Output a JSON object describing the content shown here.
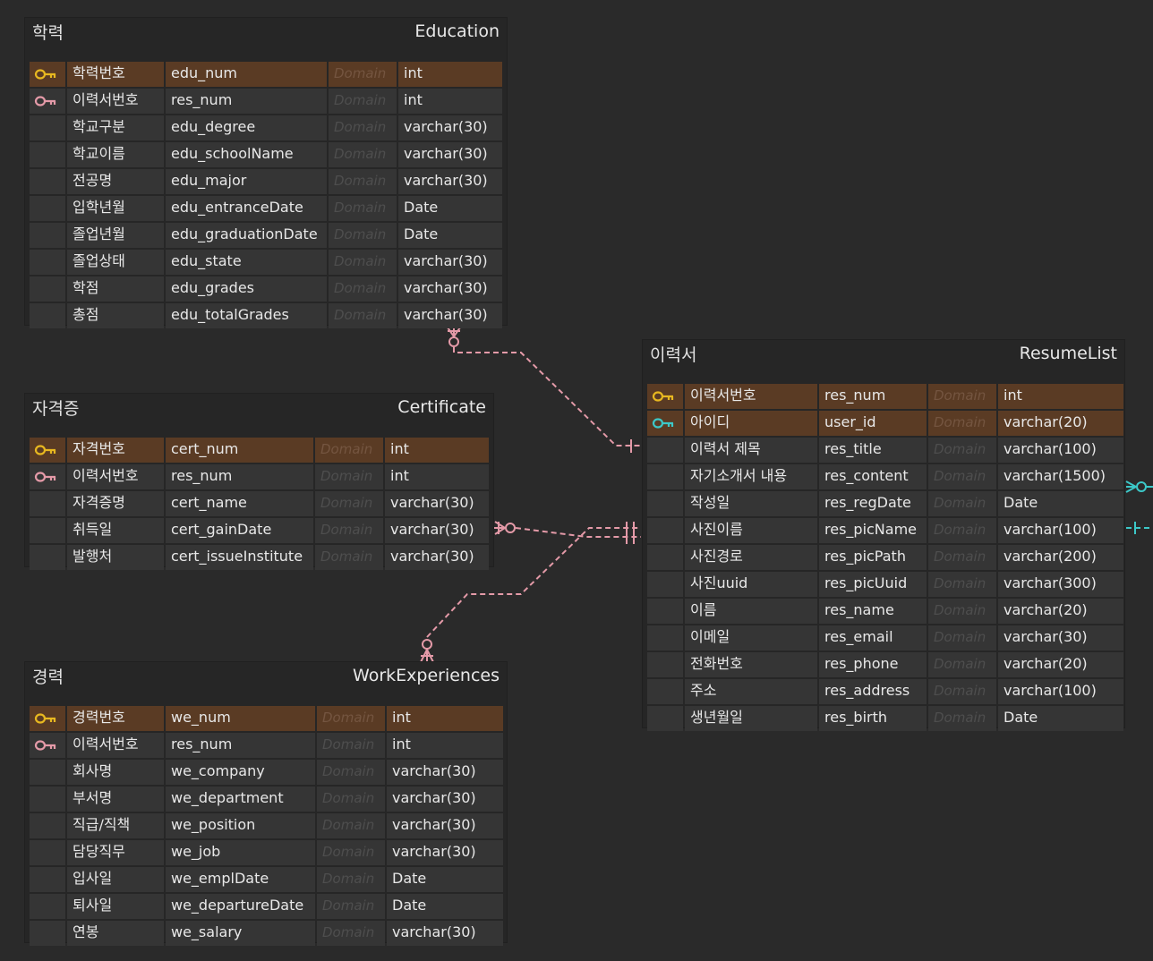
{
  "domain_placeholder": "Domain",
  "tables": {
    "education": {
      "ko": "학력",
      "en": "Education",
      "rows": [
        {
          "ko": "학력번호",
          "col": "edu_num",
          "type": "int",
          "key": "pk"
        },
        {
          "ko": "이력서번호",
          "col": "res_num",
          "type": "int",
          "key": "fk"
        },
        {
          "ko": "학교구분",
          "col": "edu_degree",
          "type": "varchar(30)",
          "key": ""
        },
        {
          "ko": "학교이름",
          "col": "edu_schoolName",
          "type": "varchar(30)",
          "key": ""
        },
        {
          "ko": "전공명",
          "col": "edu_major",
          "type": "varchar(30)",
          "key": ""
        },
        {
          "ko": "입학년월",
          "col": "edu_entranceDate",
          "type": "Date",
          "key": ""
        },
        {
          "ko": "졸업년월",
          "col": "edu_graduationDate",
          "type": "Date",
          "key": ""
        },
        {
          "ko": "졸업상태",
          "col": "edu_state",
          "type": "varchar(30)",
          "key": ""
        },
        {
          "ko": "학점",
          "col": "edu_grades",
          "type": "varchar(30)",
          "key": ""
        },
        {
          "ko": "총점",
          "col": "edu_totalGrades",
          "type": "varchar(30)",
          "key": ""
        }
      ]
    },
    "certificate": {
      "ko": "자격증",
      "en": "Certificate",
      "rows": [
        {
          "ko": "자격번호",
          "col": "cert_num",
          "type": "int",
          "key": "pk"
        },
        {
          "ko": "이력서번호",
          "col": "res_num",
          "type": "int",
          "key": "fk"
        },
        {
          "ko": "자격증명",
          "col": "cert_name",
          "type": "varchar(30)",
          "key": ""
        },
        {
          "ko": "취득일",
          "col": "cert_gainDate",
          "type": "varchar(30)",
          "key": ""
        },
        {
          "ko": "발행처",
          "col": "cert_issueInstitute",
          "type": "varchar(30)",
          "key": ""
        }
      ]
    },
    "work": {
      "ko": "경력",
      "en": "WorkExperiences",
      "rows": [
        {
          "ko": "경력번호",
          "col": "we_num",
          "type": "int",
          "key": "pk"
        },
        {
          "ko": "이력서번호",
          "col": "res_num",
          "type": "int",
          "key": "fk"
        },
        {
          "ko": "회사명",
          "col": "we_company",
          "type": "varchar(30)",
          "key": ""
        },
        {
          "ko": "부서명",
          "col": "we_department",
          "type": "varchar(30)",
          "key": ""
        },
        {
          "ko": "직급/직책",
          "col": "we_position",
          "type": "varchar(30)",
          "key": ""
        },
        {
          "ko": "담당직무",
          "col": "we_job",
          "type": "varchar(30)",
          "key": ""
        },
        {
          "ko": "입사일",
          "col": "we_emplDate",
          "type": "Date",
          "key": ""
        },
        {
          "ko": "퇴사일",
          "col": "we_departureDate",
          "type": "Date",
          "key": ""
        },
        {
          "ko": "연봉",
          "col": "we_salary",
          "type": "varchar(30)",
          "key": ""
        }
      ]
    },
    "resume": {
      "ko": "이력서",
      "en": "ResumeList",
      "rows": [
        {
          "ko": "이력서번호",
          "col": "res_num",
          "type": "int",
          "key": "pk"
        },
        {
          "ko": "아이디",
          "col": "user_id",
          "type": "varchar(20)",
          "key": "pkfk"
        },
        {
          "ko": "이력서 제목",
          "col": "res_title",
          "type": "varchar(100)",
          "key": ""
        },
        {
          "ko": "자기소개서 내용",
          "col": "res_content",
          "type": "varchar(1500)",
          "key": ""
        },
        {
          "ko": "작성일",
          "col": "res_regDate",
          "type": "Date",
          "key": ""
        },
        {
          "ko": "사진이름",
          "col": "res_picName",
          "type": "varchar(100)",
          "key": ""
        },
        {
          "ko": "사진경로",
          "col": "res_picPath",
          "type": "varchar(200)",
          "key": ""
        },
        {
          "ko": "사진uuid",
          "col": "res_picUuid",
          "type": "varchar(300)",
          "key": ""
        },
        {
          "ko": "이름",
          "col": "res_name",
          "type": "varchar(20)",
          "key": ""
        },
        {
          "ko": "이메일",
          "col": "res_email",
          "type": "varchar(30)",
          "key": ""
        },
        {
          "ko": "전화번호",
          "col": "res_phone",
          "type": "varchar(20)",
          "key": ""
        },
        {
          "ko": "주소",
          "col": "res_address",
          "type": "varchar(100)",
          "key": ""
        },
        {
          "ko": "생년월일",
          "col": "res_birth",
          "type": "Date",
          "key": ""
        }
      ]
    }
  },
  "colors": {
    "pk_key": "#e8b820",
    "fk_key": "#e49aa8",
    "pkfk_key": "#3cc8c8",
    "relation_line": "#e49aa8",
    "relation_line_alt": "#3cc8c8"
  }
}
